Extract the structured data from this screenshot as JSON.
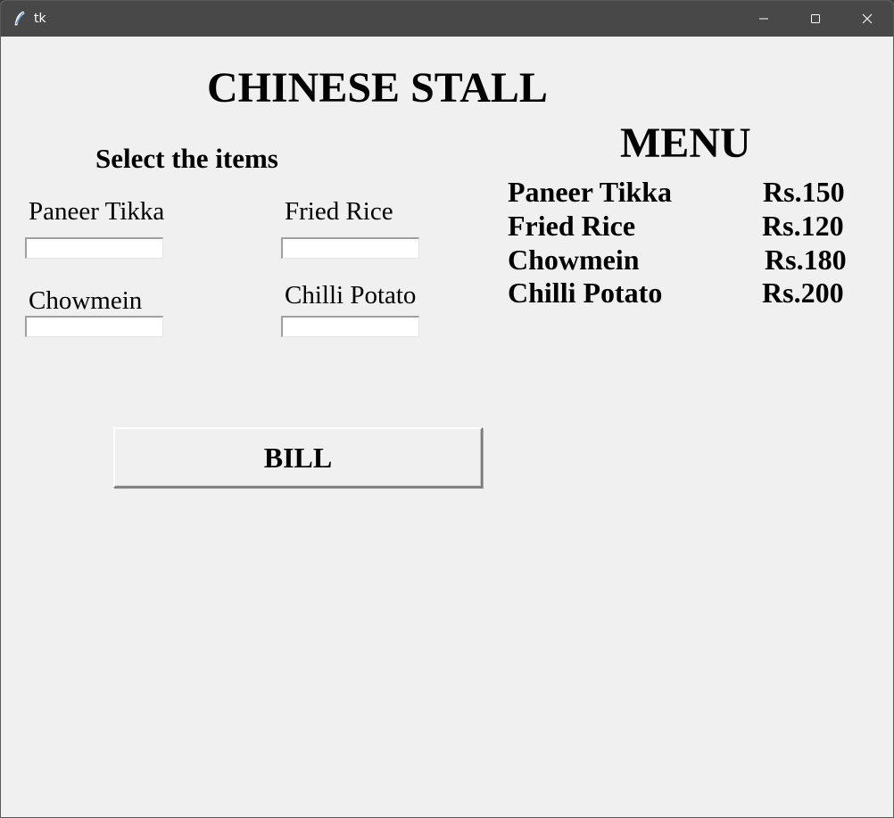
{
  "window": {
    "title": "tk",
    "icon": "tk-feather-icon",
    "controls": [
      "minimize-icon",
      "maximize-icon",
      "close-icon"
    ]
  },
  "app": {
    "title": "CHINESE STALL",
    "select_heading": "Select the items",
    "items": [
      {
        "label": "Paneer Tikka",
        "value": ""
      },
      {
        "label": "Fried Rice",
        "value": ""
      },
      {
        "label": "Chowmein",
        "value": ""
      },
      {
        "label": "Chilli Potato",
        "value": ""
      }
    ],
    "bill_label": "BILL",
    "menu": {
      "title": "MENU",
      "entries": [
        {
          "name": "Paneer Tikka",
          "price": "Rs.150"
        },
        {
          "name": "Fried Rice",
          "price": "Rs.120"
        },
        {
          "name": "Chowmein",
          "price": "Rs.180"
        },
        {
          "name": "Chilli Potato",
          "price": "Rs.200"
        }
      ]
    }
  }
}
